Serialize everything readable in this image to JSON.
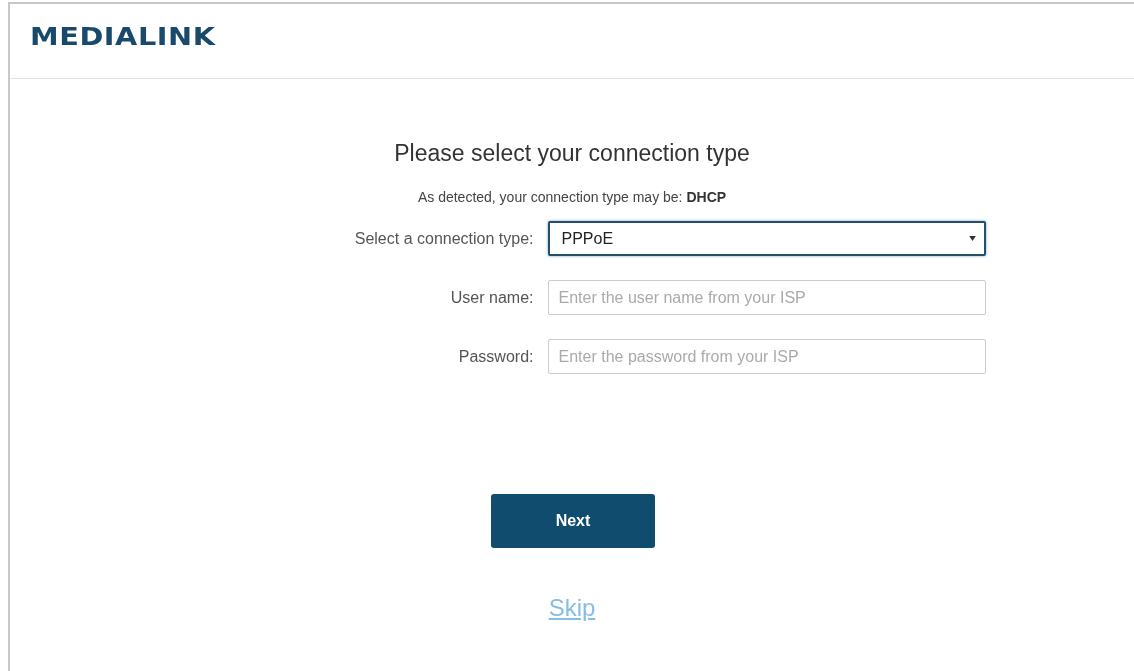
{
  "header": {
    "logo": "MEDIALINK"
  },
  "title": "Please select your connection type",
  "detected": "As detected, your connection type may be: **DHCP**",
  "fields": [
    {
      "kind": "select",
      "label": "Select a connection type:",
      "value": "PPPoE",
      "focused": true
    },
    {
      "kind": "text",
      "label": "User name:",
      "placeholder": "Enter the user name from your ISP",
      "focused": false
    },
    {
      "kind": "text",
      "label": "Password:",
      "placeholder": "Enter the password from your ISP",
      "focused": false
    }
  ],
  "next_button": "Next",
  "skip_link": "Skip"
}
